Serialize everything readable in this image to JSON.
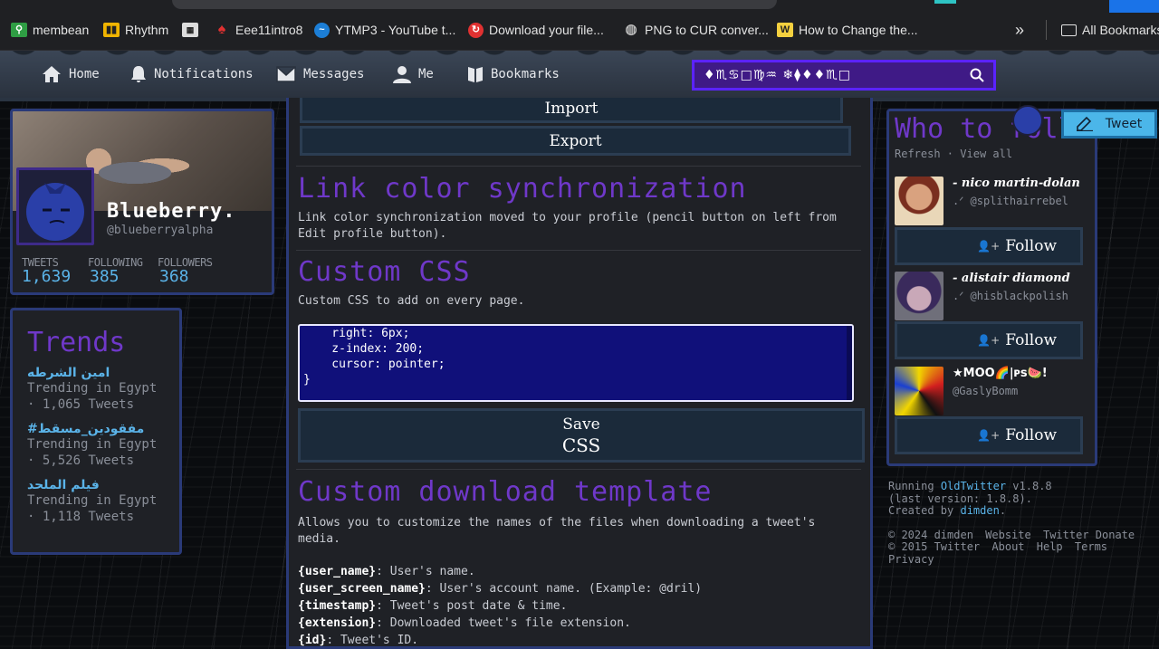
{
  "bookmarks": [
    {
      "label": "membean",
      "icon": "membean-icon",
      "color": "#2f9e44"
    },
    {
      "label": "Rhythm",
      "icon": "rhythm-icon",
      "color": "#f0b400"
    },
    {
      "label": "",
      "icon": "calculator-icon",
      "color": "#dddddd"
    },
    {
      "label": "Eee11intro8",
      "icon": "flame-icon",
      "color": "#e03131"
    },
    {
      "label": "YTMP3 - YouTube t...",
      "icon": "ytmp3-icon",
      "color": "#1c7ed6"
    },
    {
      "label": "Download your file...",
      "icon": "download-site-icon",
      "color": "#e03131"
    },
    {
      "label": "PNG to CUR conver...",
      "icon": "globe-icon",
      "color": "#aaaaaa"
    },
    {
      "label": "How to Change the...",
      "icon": "wikihow-icon",
      "color": "#f4d03f"
    },
    {
      "label": "»",
      "icon": "more-chevron-icon",
      "color": "#e3e3e3"
    },
    {
      "label": "All Bookmarks",
      "icon": "folder-icon",
      "color": "#e3e3e3"
    }
  ],
  "nav": {
    "home": "Home",
    "notifications": "Notifications",
    "messages": "Messages",
    "me": "Me",
    "bookmarks": "Bookmarks",
    "search_placeholder": "♦♏︎♋︎□︎♍︎♒︎ ❄︎⧫︎♦︎♦︎♏︎□︎"
  },
  "profile": {
    "name": "Blueberry.",
    "handle": "@blueberryalpha",
    "stats": [
      {
        "label": "TWEETS",
        "value": "1,639"
      },
      {
        "label": "FOLLOWING",
        "value": "385"
      },
      {
        "label": "FOLLOWERS",
        "value": "368"
      }
    ]
  },
  "trends": {
    "title": "Trends",
    "items": [
      {
        "name": "امين الشرطه",
        "location": "Trending in Egypt",
        "count": "· 1,065 Tweets"
      },
      {
        "name": "#مفقودين_مسقط",
        "location": "Trending in Egypt",
        "count": "· 5,526 Tweets"
      },
      {
        "name": "فيلم الملحد",
        "location": "Trending in Egypt",
        "count": "· 1,118 Tweets"
      }
    ]
  },
  "main": {
    "import_label": "Import",
    "export_label": "Export",
    "link_title": "Link color synchronization",
    "link_desc": "Link color synchronization moved to your profile (pencil button on left from Edit profile button).",
    "css_title": "Custom CSS",
    "css_desc": "Custom CSS to add on every page.",
    "css_code": "    right: 6px;\n    z-index: 200;\n    cursor: pointer;\n}\n",
    "save_line1": "Save",
    "save_line2": "CSS",
    "download_title": "Custom download template",
    "download_desc": "Allows you to customize the names of the files when downloading a tweet's media.",
    "tokens": [
      {
        "key": "{user_name}",
        "desc": ": User's name."
      },
      {
        "key": "{user_screen_name}",
        "desc": ": User's account name. (Example: @dril)"
      },
      {
        "key": "{timestamp}",
        "desc": ": Tweet's post date & time."
      },
      {
        "key": "{extension}",
        "desc": ": Downloaded tweet's file extension."
      },
      {
        "key": "{id}",
        "desc": ": Tweet's ID."
      }
    ]
  },
  "who_to_follow": {
    "title": "Who to foll",
    "refresh": "Refresh",
    "view_all": "View all",
    "users": [
      {
        "name": "- nico martin-dolan",
        "handle": ".ᐟ @splithairrebel"
      },
      {
        "name": "- alistair diamond",
        "handle": ".ᐟ @hisblackpolish"
      },
      {
        "name": "★MOO🌈|ᴘs🍉!",
        "handle": "@GaslyBomm"
      }
    ],
    "follow_label": "Follow"
  },
  "tweet_button": "Tweet",
  "footer": {
    "running": "Running",
    "app": "OldTwitter",
    "version": "v1.8.8",
    "last_version": "(last version: 1.8.8).",
    "created_by": "Created by",
    "author": "dimden",
    "copy1": "© 2024 dimden",
    "website": "Website",
    "twitter": "Twitter",
    "donate": "Donate",
    "copy2": "© 2015 Twitter",
    "about": "About",
    "help": "Help",
    "terms": "Terms",
    "privacy": "Privacy"
  },
  "colors": {
    "accent": "#6f38c9",
    "link": "#5ab3e8",
    "search_border": "#5b23ff",
    "tweet_button": "#4bb6e9"
  }
}
